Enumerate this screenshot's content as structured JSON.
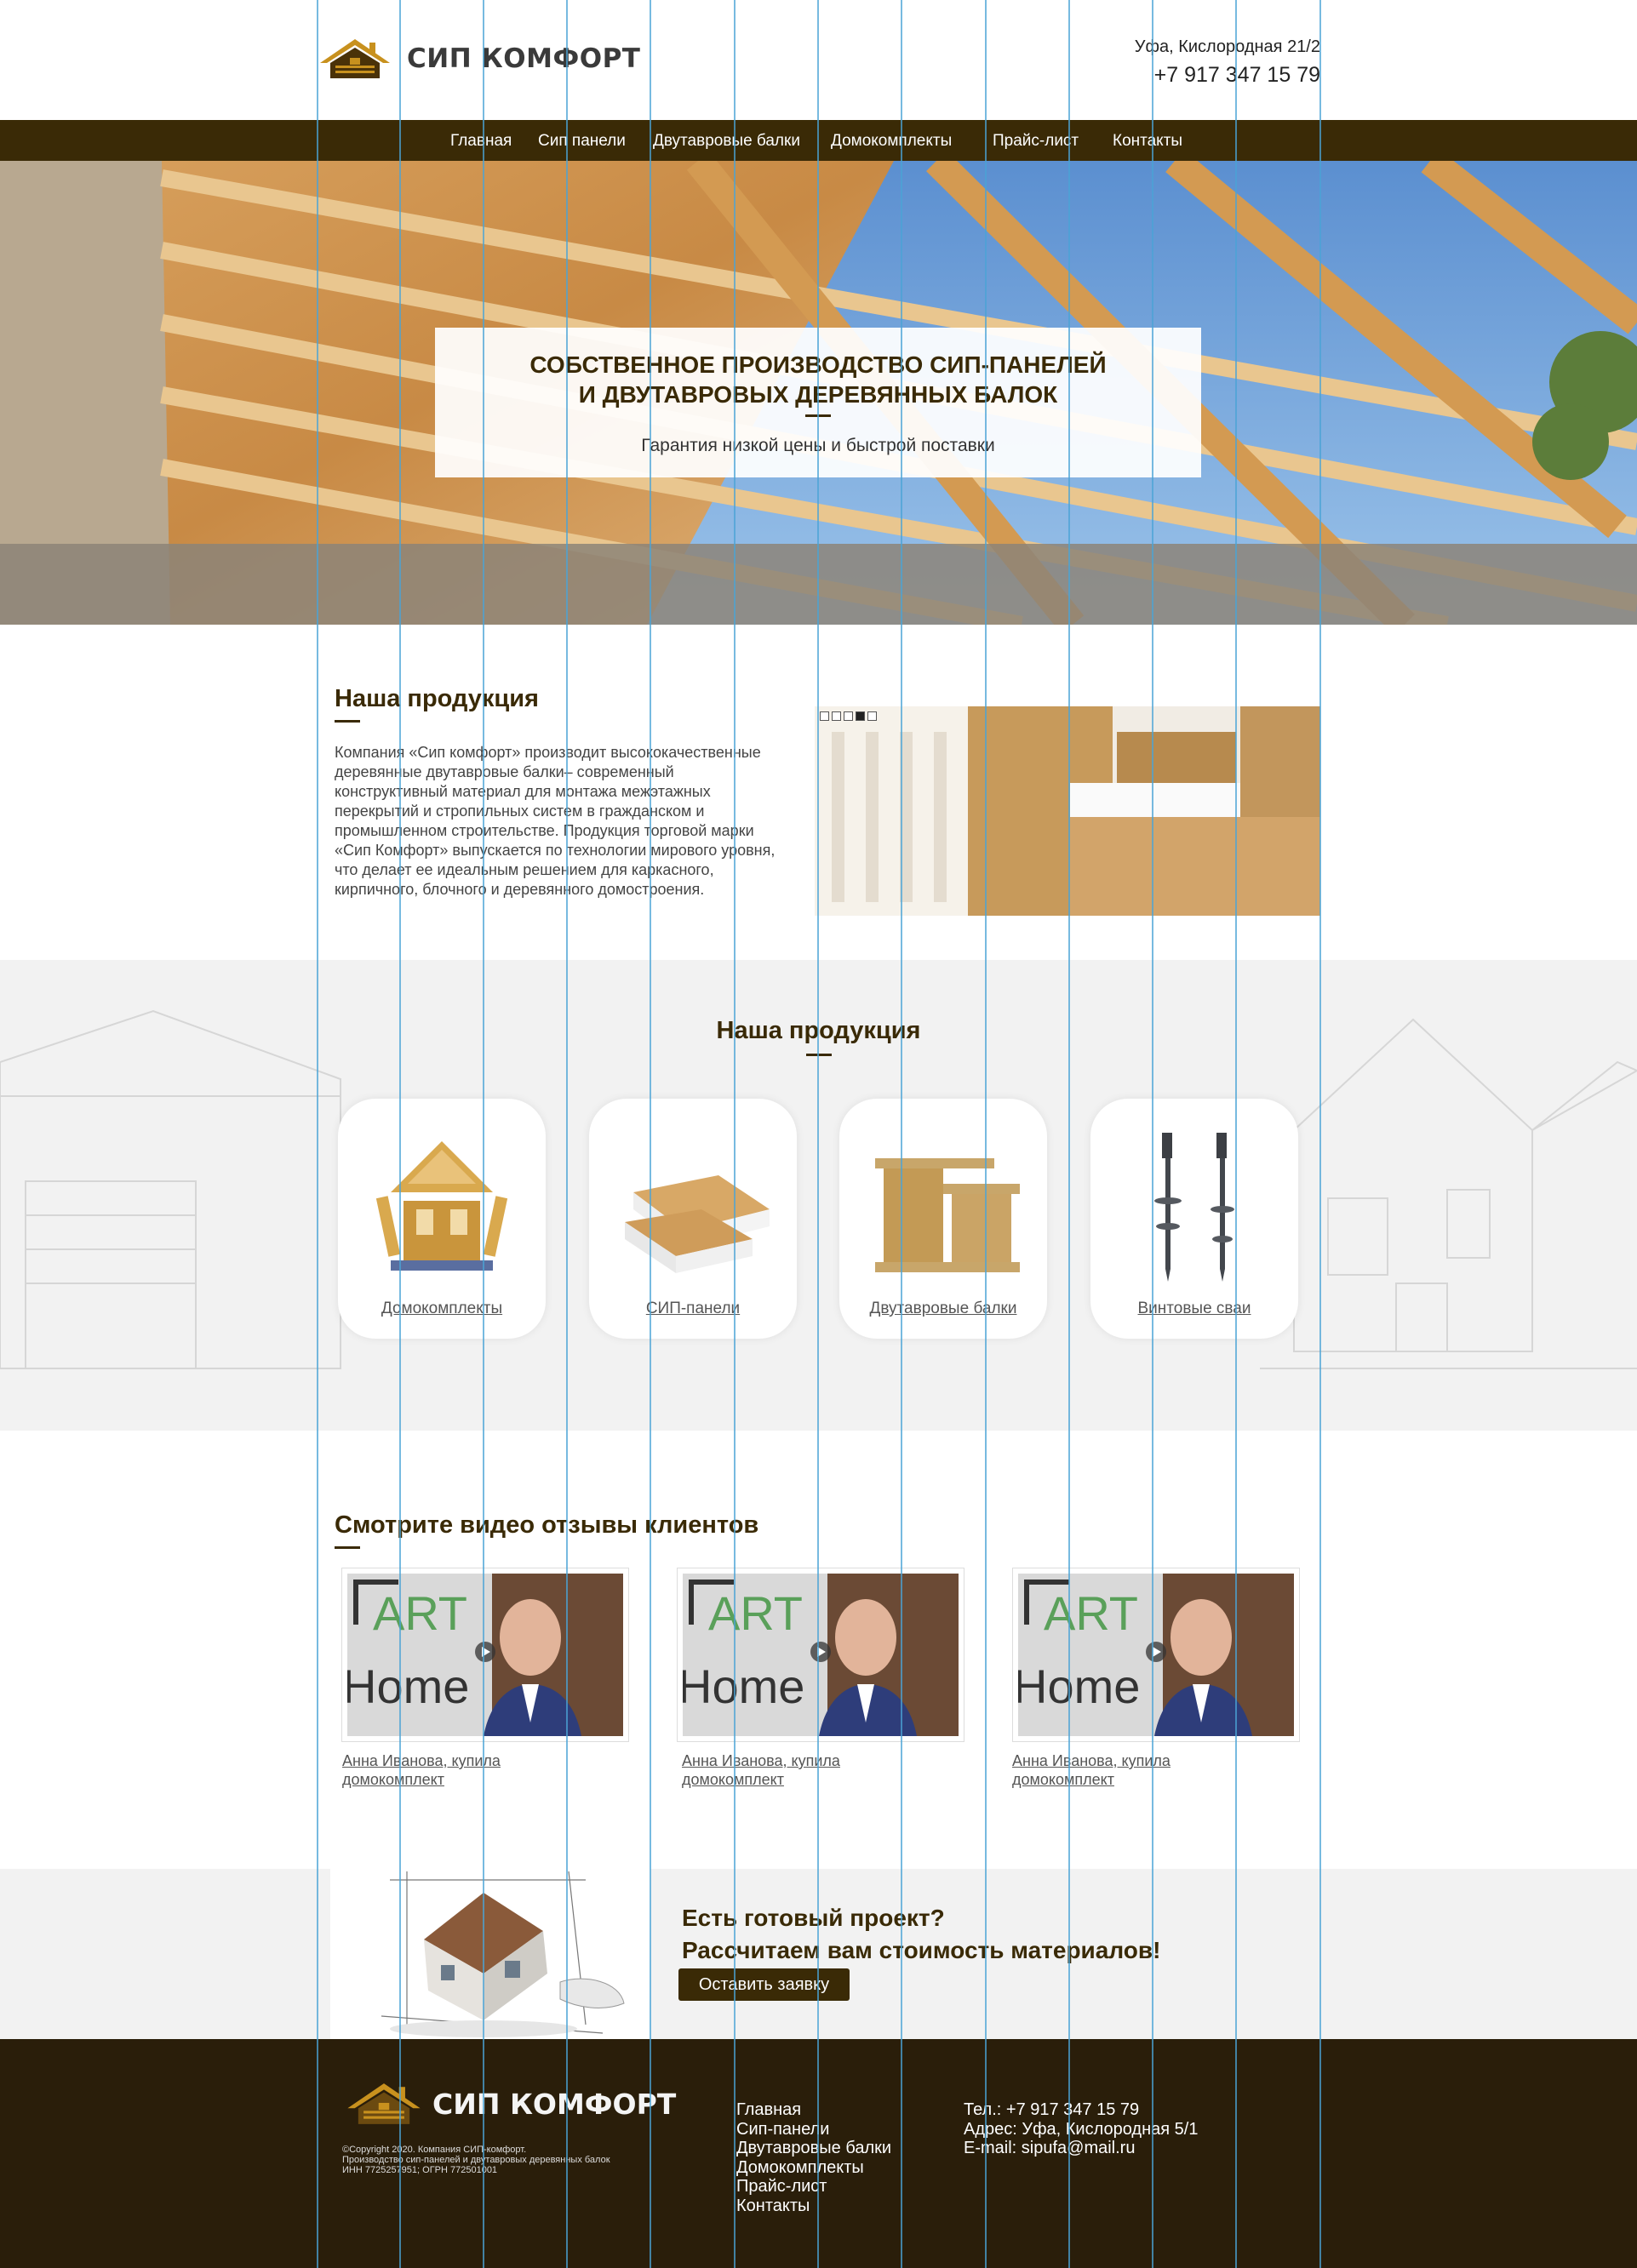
{
  "header": {
    "logo_text": "СИП КОМФОРТ",
    "address": "Уфа, Кислородная 21/2",
    "phone": "+7 917 347 15 79"
  },
  "nav": {
    "items": [
      "Главная",
      "Сип панели",
      "Двутавровые балки",
      "Домокомплекты",
      "Прайс-лист",
      "Контакты"
    ]
  },
  "hero": {
    "title_line1": "СОБСТВЕННОЕ ПРОИЗВОДСТВО СИП-ПАНЕЛЕЙ",
    "title_line2": "И ДВУТАВРОВЫХ ДЕРЕВЯННЫХ БАЛОК",
    "subtitle": "Гарантия низкой цены и быстрой поставки"
  },
  "about": {
    "title": "Наша продукция",
    "text": "Компания  «Сип комфорт» производит высококачественные деревянные двутавровые балки– современный конструктивный материал для монтажа межэтажных перекрытий и стропильных систем в гражданском и промышленном строительстве. Продукция торговой марки «Сип Комфорт» выпускается по технологии мирового уровня, что делает ее идеальным решением для каркасного, кирпичного, блочного и деревянного домостроения.",
    "slider_dots": 5,
    "active_dot": 4
  },
  "products": {
    "title": "Наша продукция",
    "items": [
      {
        "label": "Домокомплекты",
        "icon": "house-kit-icon"
      },
      {
        "label": "СИП-панели",
        "icon": "sip-panels-icon"
      },
      {
        "label": "Двутавровые балки",
        "icon": "i-beams-icon"
      },
      {
        "label": "Винтовые сваи",
        "icon": "screw-piles-icon"
      }
    ]
  },
  "videos": {
    "title": "Смотрите видео отзывы клиентов",
    "items": [
      {
        "caption": "Анна Иванова, купила домокомплект",
        "brand_top": "ART",
        "brand_bottom": "Home"
      },
      {
        "caption": "Анна Иванова, купила домокомплект",
        "brand_top": "ART",
        "brand_bottom": "Home"
      },
      {
        "caption": "Анна Иванова, купила домокомплект",
        "brand_top": "ART",
        "brand_bottom": "Home"
      }
    ]
  },
  "cta": {
    "title_line1": "Есть готовый проект?",
    "title_line2": "Рассчитаем вам стоимость материалов!",
    "button": "Оставить заявку"
  },
  "footer": {
    "logo_text": "СИП КОМФОРТ",
    "copyright_line1": "©Copyright 2020. Компания СИП-комфорт.",
    "copyright_line2": "Производство сип-панелей и двутавровых деревянных балок",
    "copyright_line3": "ИНН 7725257951; ОГРН 772501001",
    "menu": [
      "Главная",
      "Сип-панели",
      "Двутавровые балки",
      "Домокомплекты",
      "Прайс-лист",
      "Контакты"
    ],
    "contacts": [
      "Тел.: +7 917 347 15 79",
      "Адрес: Уфа, Кислородная 5/1",
      "E-mail: sipufa@mail.ru"
    ]
  },
  "colors": {
    "brand_dark": "#3a2a06",
    "footer_bg": "#2a1e0a",
    "logo_gold": "#c8911e",
    "guide_blue": "#4aa3d6"
  }
}
